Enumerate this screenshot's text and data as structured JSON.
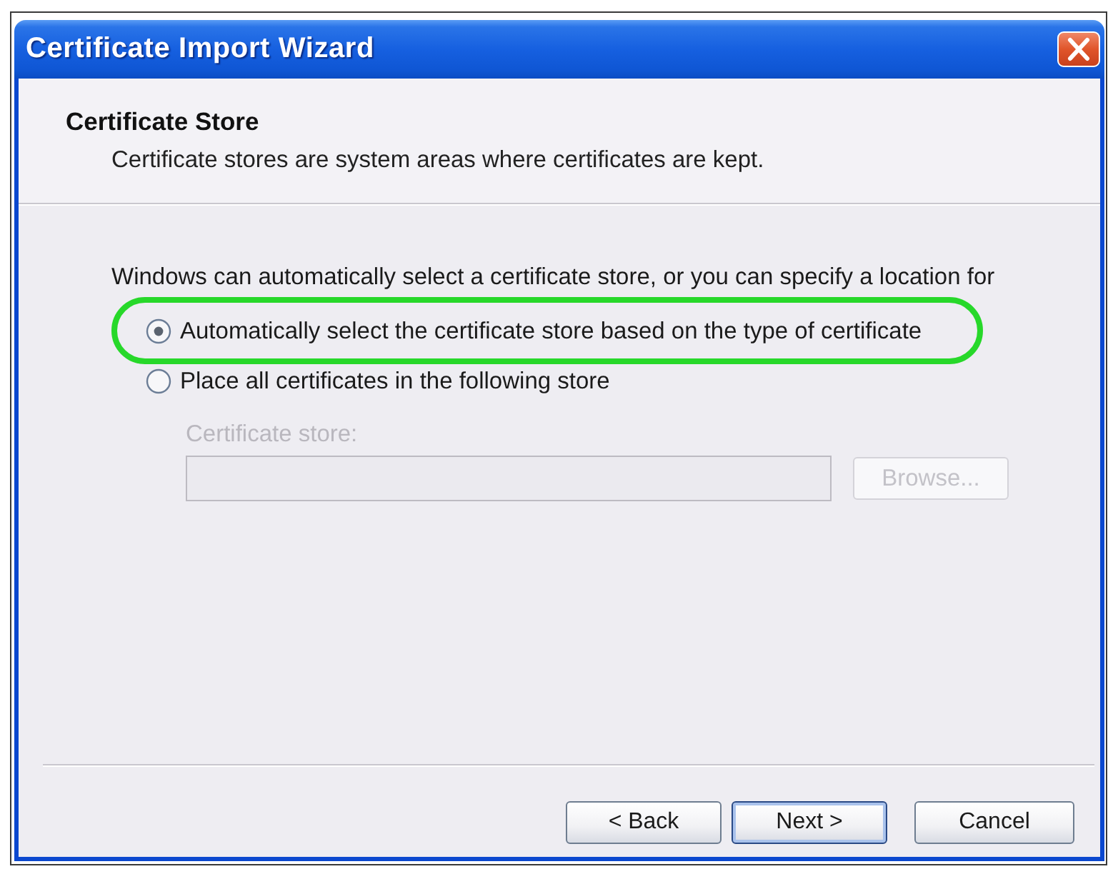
{
  "window": {
    "title": "Certificate Import Wizard"
  },
  "header": {
    "title": "Certificate Store",
    "subtitle": "Certificate stores are system areas where certificates are kept."
  },
  "body": {
    "intro": "Windows can automatically select a certificate store, or you can specify a location for",
    "options": [
      {
        "label": "Automatically select the certificate store based on the type of certificate",
        "selected": true,
        "highlighted": true
      },
      {
        "label": "Place all certificates in the following store",
        "selected": false,
        "highlighted": false
      }
    ],
    "store_field": {
      "label": "Certificate store:",
      "disabled": true
    },
    "browse_button": {
      "label": "Browse...",
      "disabled": true
    }
  },
  "buttons": [
    {
      "label": "< Back",
      "default": false
    },
    {
      "label": "Next >",
      "default": true
    },
    {
      "label": "Cancel",
      "default": false
    }
  ]
}
